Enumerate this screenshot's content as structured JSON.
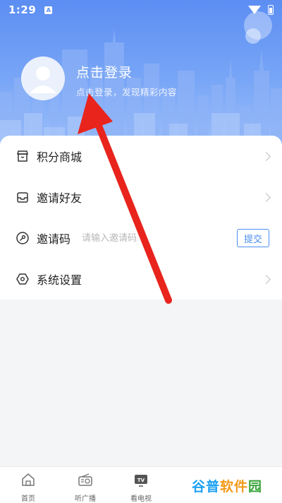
{
  "status_bar": {
    "time": "1:29",
    "notif_letter": "A"
  },
  "profile": {
    "title": "点击登录",
    "subtitle": "点击登录，发现精彩内容"
  },
  "menu": {
    "points_mall": "积分商城",
    "invite_friends": "邀请好友",
    "invite_code": {
      "label": "邀请码",
      "placeholder": "请输入邀请码",
      "submit": "提交"
    },
    "settings": "系统设置"
  },
  "bottom_nav": {
    "items": [
      {
        "label": "首页",
        "icon": "home-icon"
      },
      {
        "label": "听广播",
        "icon": "radio-icon"
      },
      {
        "label": "看电视",
        "icon": "tv-icon"
      }
    ]
  },
  "watermark": {
    "part1": "谷普",
    "part2": "软件",
    "part3": "园"
  },
  "colors": {
    "header": "#5c8ef3",
    "accent": "#4a8ef0",
    "arrow": "#e8241d"
  }
}
